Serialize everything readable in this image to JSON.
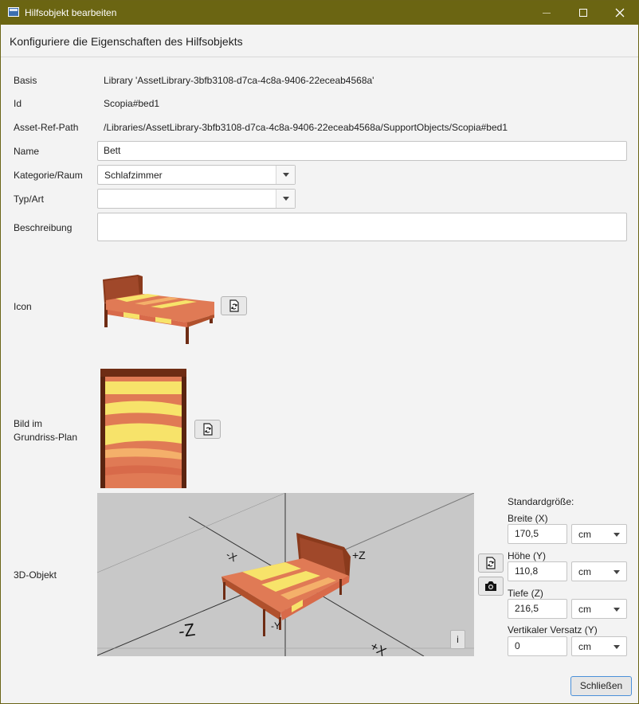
{
  "window": {
    "title": "Hilfsobjekt bearbeiten",
    "header": "Konfiguriere die Eigenschaften des Hilfsobjekts"
  },
  "form": {
    "basis_label": "Basis",
    "basis_value": "Library 'AssetLibrary-3bfb3108-d7ca-4c8a-9406-22eceab4568a'",
    "id_label": "Id",
    "id_value": "Scopia#bed1",
    "path_label": "Asset-Ref-Path",
    "path_value": "/Libraries/AssetLibrary-3bfb3108-d7ca-4c8a-9406-22eceab4568a/SupportObjects/Scopia#bed1",
    "name_label": "Name",
    "name_value": "Bett",
    "category_label": "Kategorie/Raum",
    "category_value": "Schlafzimmer",
    "type_label": "Typ/Art",
    "type_value": "",
    "description_label": "Beschreibung",
    "description_value": "",
    "icon_label": "Icon",
    "floorplan_label_line1": "Bild im",
    "floorplan_label_line2": "Grundriss-Plan",
    "object3d_label": "3D-Objekt"
  },
  "viewport": {
    "axis_neg_z": "-Z",
    "axis_pos_z": "+Z",
    "axis_neg_x": "-X",
    "axis_neg_y": "-Y",
    "axis_pos_x": "+X",
    "info_button": "i"
  },
  "size": {
    "heading": "Standardgröße:",
    "width_label": "Breite (X)",
    "width_value": "170,5",
    "width_unit": "cm",
    "height_label": "Höhe (Y)",
    "height_value": "110,8",
    "height_unit": "cm",
    "depth_label": "Tiefe (Z)",
    "depth_value": "216,5",
    "depth_unit": "cm",
    "offset_label": "Vertikaler Versatz (Y)",
    "offset_value": "0",
    "offset_unit": "cm"
  },
  "footer": {
    "close_label": "Schließen"
  },
  "colors": {
    "titlebar": "#6b6512",
    "bed_wood": "#8a3a1c",
    "bed_stripe_yellow": "#f7e36a",
    "bed_stripe_orange": "#e07a55"
  },
  "icons": [
    "app-icon",
    "minimize-icon",
    "maximize-icon",
    "close-icon",
    "chevron-down-icon",
    "replace-image-icon",
    "camera-icon"
  ]
}
